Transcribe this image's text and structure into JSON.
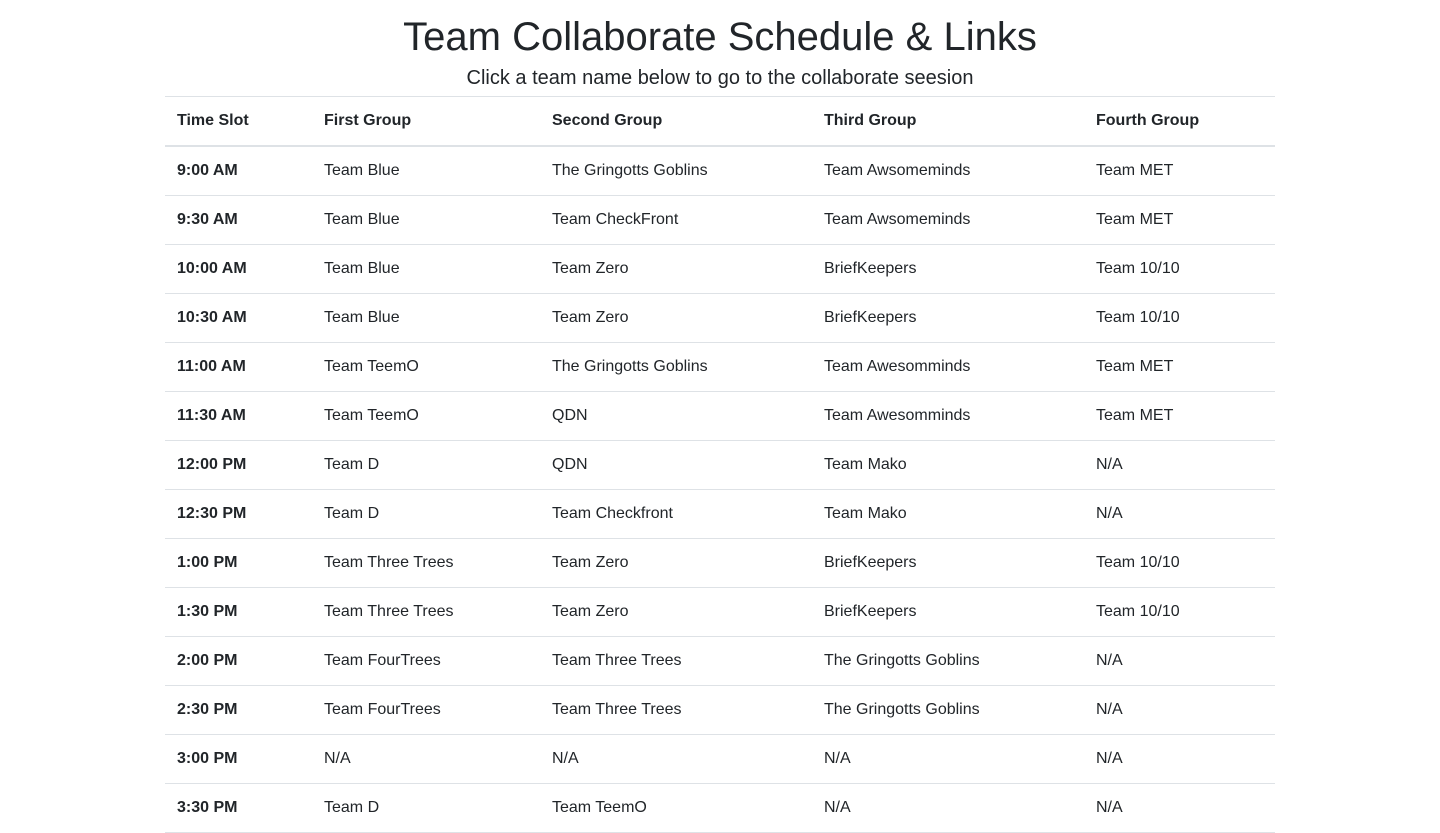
{
  "title": "Team Collaborate Schedule & Links",
  "subtitle": "Click a team name below to go to the collaborate seesion",
  "headers": [
    "Time Slot",
    "First Group",
    "Second Group",
    "Third Group",
    "Fourth Group"
  ],
  "rows": [
    [
      "9:00 AM",
      "Team Blue",
      "The Gringotts Goblins",
      "Team Awsomeminds",
      "Team MET"
    ],
    [
      "9:30 AM",
      "Team Blue",
      "Team CheckFront",
      "Team Awsomeminds",
      "Team MET"
    ],
    [
      "10:00 AM",
      "Team Blue",
      "Team Zero",
      "BriefKeepers",
      "Team 10/10"
    ],
    [
      "10:30 AM",
      "Team Blue",
      "Team Zero",
      "BriefKeepers",
      "Team 10/10"
    ],
    [
      "11:00 AM",
      "Team TeemO",
      "The Gringotts Goblins",
      "Team Awesomminds",
      "Team MET"
    ],
    [
      "11:30 AM",
      "Team TeemO",
      "QDN",
      "Team Awesomminds",
      "Team MET"
    ],
    [
      "12:00 PM",
      "Team D",
      "QDN",
      "Team Mako",
      "N/A"
    ],
    [
      "12:30 PM",
      "Team D",
      "Team Checkfront",
      "Team Mako",
      "N/A"
    ],
    [
      "1:00 PM",
      "Team Three Trees",
      "Team Zero",
      "BriefKeepers",
      "Team 10/10"
    ],
    [
      "1:30 PM",
      "Team Three Trees",
      "Team Zero",
      "BriefKeepers",
      "Team 10/10"
    ],
    [
      "2:00 PM",
      "Team FourTrees",
      "Team Three Trees",
      "The Gringotts Goblins",
      "N/A"
    ],
    [
      "2:30 PM",
      "Team FourTrees",
      "Team Three Trees",
      "The Gringotts Goblins",
      "N/A"
    ],
    [
      "3:00 PM",
      "N/A",
      "N/A",
      "N/A",
      "N/A"
    ],
    [
      "3:30 PM",
      "Team D",
      "Team TeemO",
      "N/A",
      "N/A"
    ]
  ]
}
